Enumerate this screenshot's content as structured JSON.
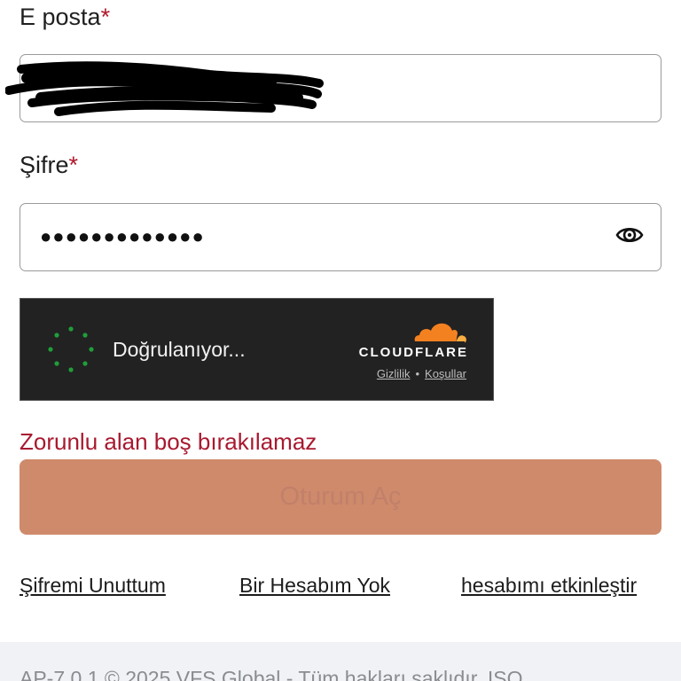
{
  "form": {
    "email_label": "E posta",
    "required_mark": "*",
    "email_value": "",
    "password_label": "Şifre",
    "password_masked": "●●●●●●●●●●●●●"
  },
  "captcha": {
    "status": "Doğrulanıyor...",
    "brand": "CLOUDFLARE",
    "privacy_link": "Gizlilik",
    "separator": "•",
    "terms_link": "Koşullar"
  },
  "error": {
    "message": "Zorunlu alan boş bırakılamaz"
  },
  "submit": {
    "label": "Oturum Aç"
  },
  "links": {
    "forgot_password": "Şifremi Unuttum",
    "no_account": "Bir Hesabım Yok",
    "activate_account": "hesabımı etkinleştir"
  },
  "footer": {
    "text": "AP-7.0.1 © 2025 VFS Global - Tüm hakları saklıdır. ISO"
  },
  "icons": {
    "password_toggle": "eye-icon",
    "captcha_spinner": "spinner-icon",
    "captcha_logo": "cloudflare-cloud-icon"
  },
  "colors": {
    "required": "#b0182c",
    "error": "#a8192f",
    "submit_bg": "#cf8a6c",
    "captcha_bg": "#222222",
    "cloudflare_orange": "#f48120",
    "spinner_green": "#1f9e3a"
  }
}
